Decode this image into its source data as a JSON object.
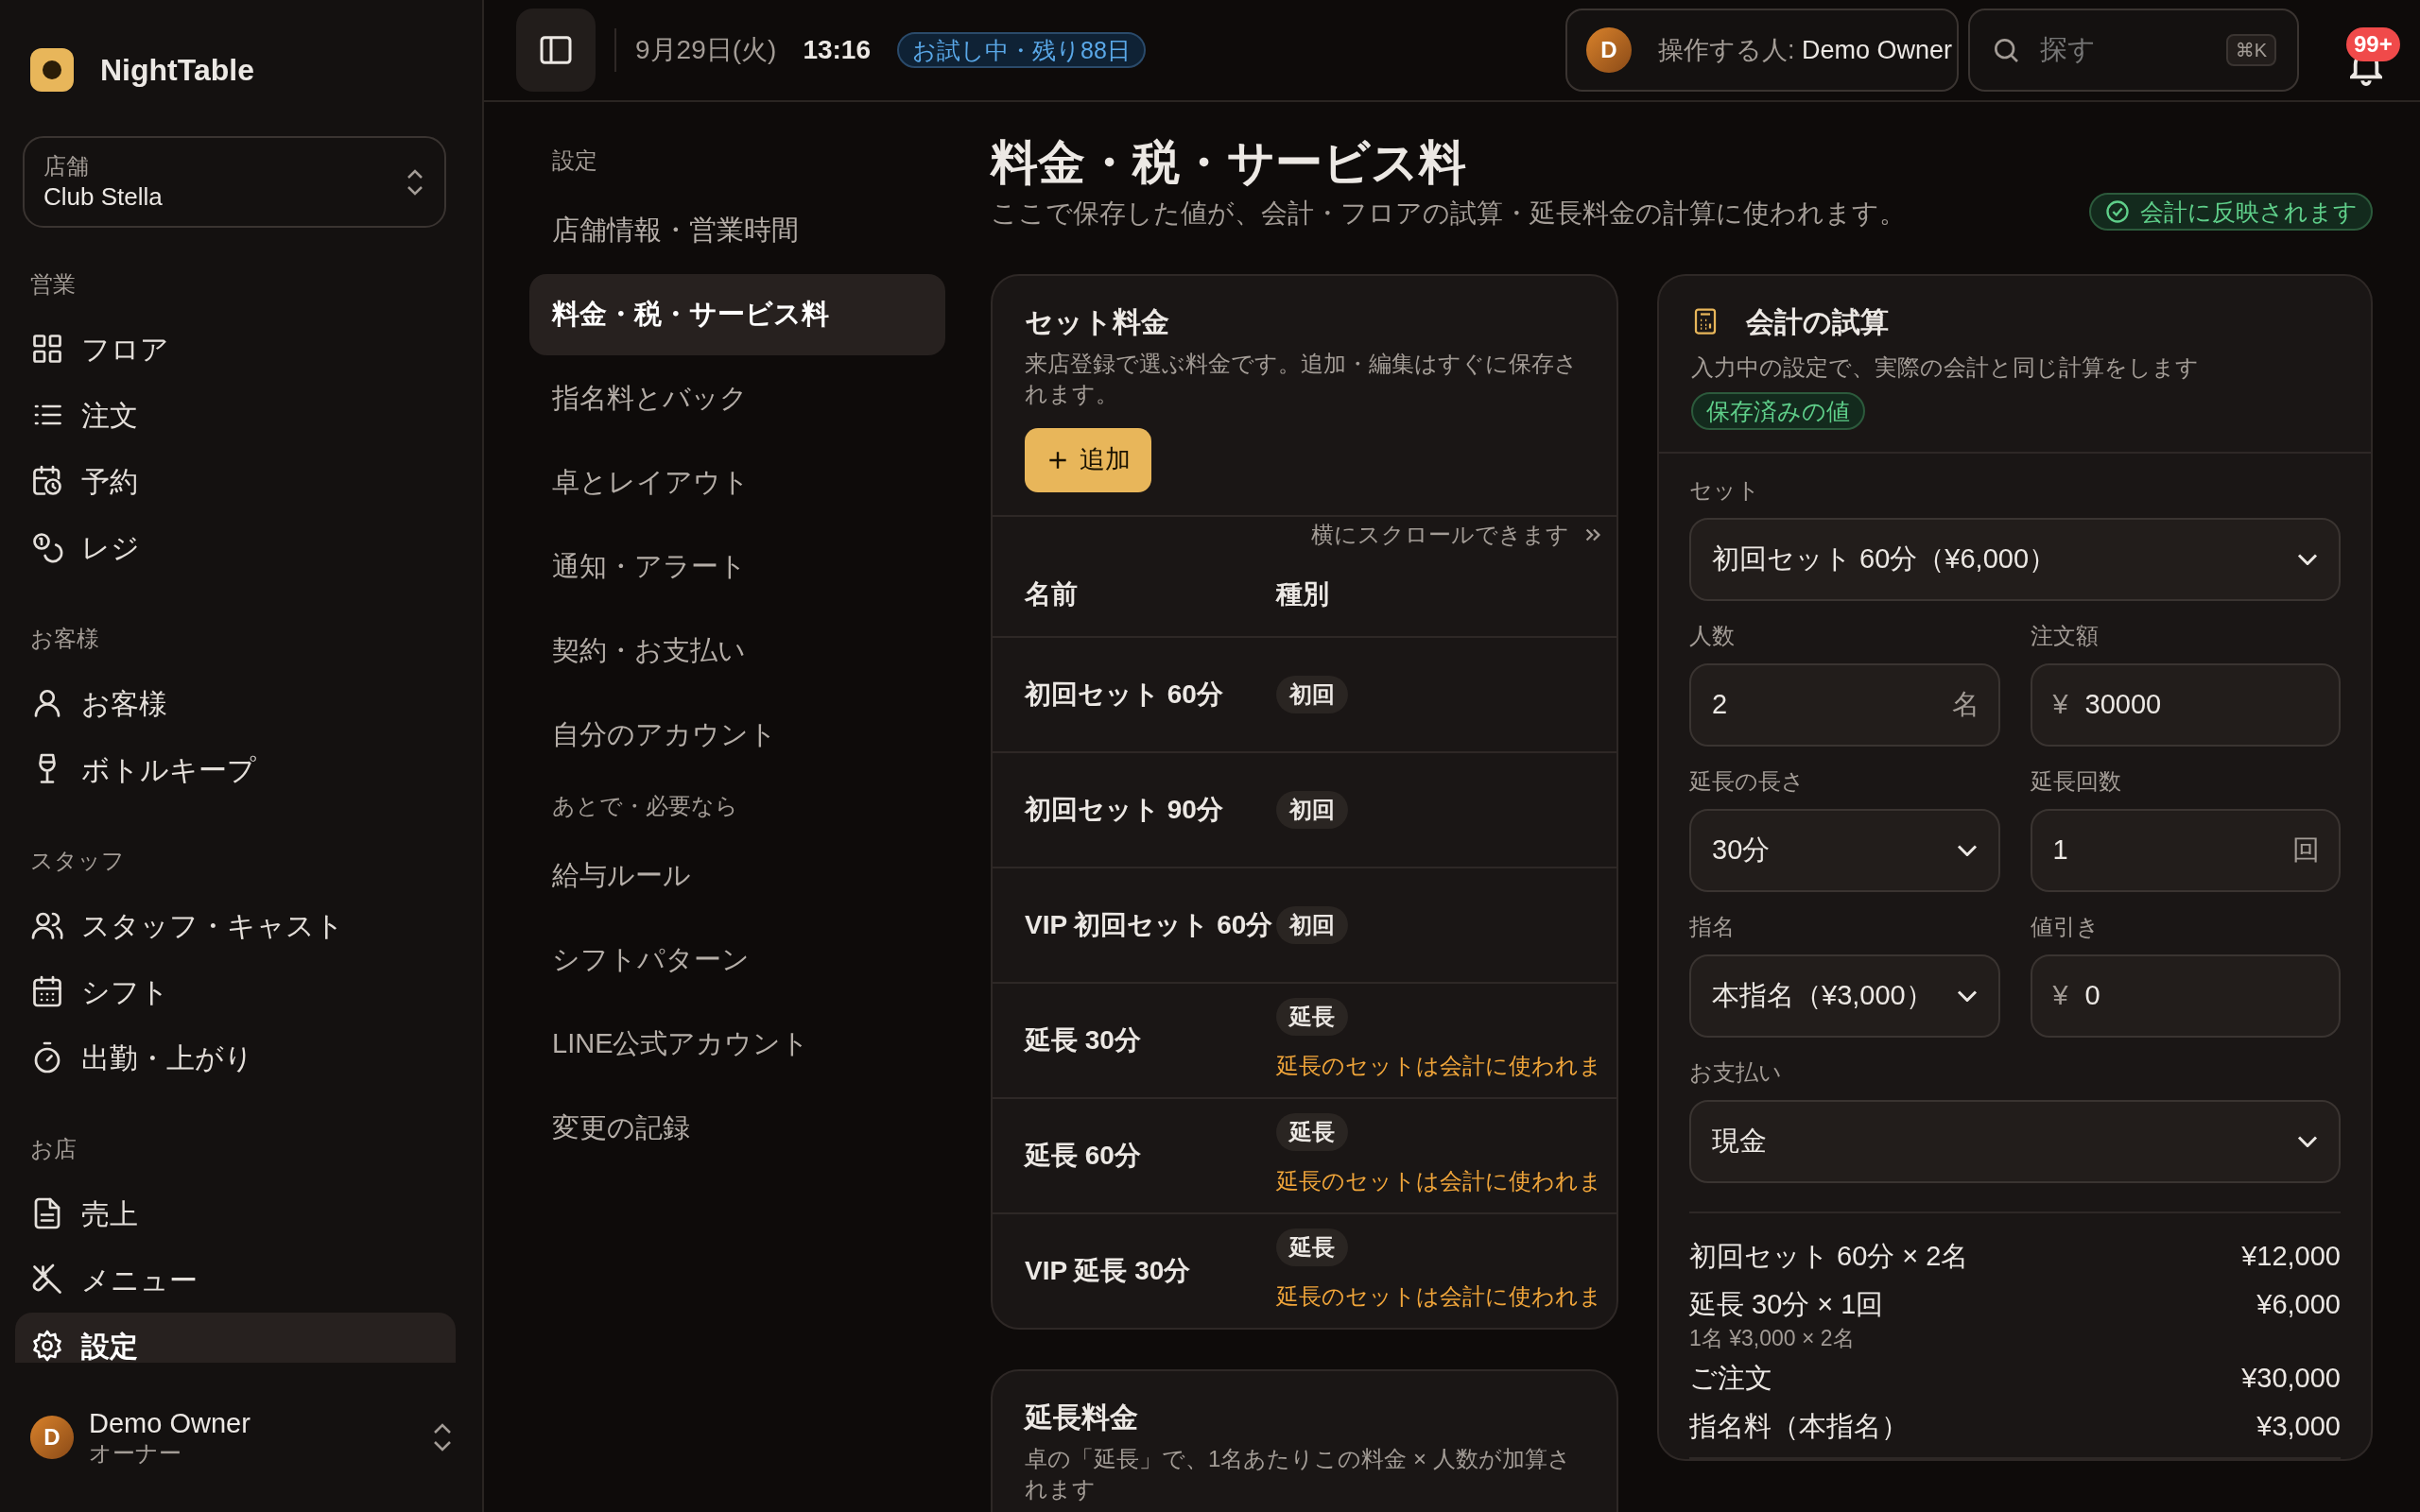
{
  "sidebar": {
    "logo": "NightTable",
    "store": {
      "label": "店舗",
      "name": "Club Stella"
    },
    "sections": [
      {
        "title": "営業",
        "items": [
          {
            "label": "フロア",
            "selected": false
          },
          {
            "label": "注文",
            "selected": false
          },
          {
            "label": "予約",
            "selected": false
          },
          {
            "label": "レジ",
            "selected": false
          }
        ]
      },
      {
        "title": "お客様",
        "items": [
          {
            "label": "お客様",
            "selected": false
          },
          {
            "label": "ボトルキープ",
            "selected": false
          }
        ]
      },
      {
        "title": "スタッフ",
        "items": [
          {
            "label": "スタッフ・キャスト",
            "selected": false
          },
          {
            "label": "シフト",
            "selected": false
          },
          {
            "label": "出勤・上がり",
            "selected": false
          }
        ]
      },
      {
        "title": "お店",
        "items": [
          {
            "label": "売上",
            "selected": false
          },
          {
            "label": "メニュー",
            "selected": false
          },
          {
            "label": "設定",
            "selected": true
          }
        ]
      }
    ],
    "user": {
      "initial": "D",
      "name": "Demo Owner",
      "role": "オーナー"
    }
  },
  "header": {
    "date": "9月29日(火)",
    "time": "13:16",
    "trial_badge": "お試し中・残り88日",
    "operator": {
      "initial": "D",
      "label": "操作する人:",
      "name": "Demo Owner"
    },
    "search": {
      "placeholder": "探す",
      "shortcut": "⌘K"
    },
    "notifications": {
      "count": "99+"
    }
  },
  "settings_nav": [
    {
      "kind": "heading",
      "label": "設定"
    },
    {
      "kind": "link",
      "label": "店舗情報・営業時間",
      "selected": false
    },
    {
      "kind": "link",
      "label": "料金・税・サービス料",
      "selected": true
    },
    {
      "kind": "link",
      "label": "指名料とバック",
      "selected": false
    },
    {
      "kind": "link",
      "label": "卓とレイアウト",
      "selected": false
    },
    {
      "kind": "link",
      "label": "通知・アラート",
      "selected": false
    },
    {
      "kind": "link",
      "label": "契約・お支払い",
      "selected": false
    },
    {
      "kind": "link",
      "label": "自分のアカウント",
      "selected": false
    },
    {
      "kind": "heading",
      "label": "あとで・必要なら"
    },
    {
      "kind": "link",
      "label": "給与ルール",
      "selected": false
    },
    {
      "kind": "link",
      "label": "シフトパターン",
      "selected": false
    },
    {
      "kind": "link",
      "label": "LINE公式アカウント",
      "selected": false
    },
    {
      "kind": "link",
      "label": "変更の記録",
      "selected": false
    }
  ],
  "page": {
    "title": "料金・税・サービス料",
    "subtitle": "ここで保存した値が、会計・フロアの試算・延長料金の計算に使われます。",
    "status_badge": "会計に反映されます"
  },
  "set_fees": {
    "title": "セット料金",
    "description": "来店登録で選ぶ料金です。追加・編集はすぐに保存されます。",
    "add_button": "追加",
    "scroll_hint": "横にスクロールできます",
    "columns": [
      "名前",
      "種別"
    ],
    "rows": [
      {
        "name": "初回セット 60分",
        "type": "初回"
      },
      {
        "name": "初回セット 90分",
        "type": "初回"
      },
      {
        "name": "VIP 初回セット 60分",
        "type": "初回"
      },
      {
        "name": "延長 30分",
        "type": "延長",
        "warning": "延長のセットは会計に使われま"
      },
      {
        "name": "延長 60分",
        "type": "延長",
        "warning": "延長のセットは会計に使われま"
      },
      {
        "name": "VIP 延長 30分",
        "type": "延長",
        "warning": "延長のセットは会計に使われま"
      }
    ]
  },
  "extension_fees": {
    "title": "延長料金",
    "description": "卓の「延長」で、1名あたりこの料金 × 人数が加算されます"
  },
  "calculator": {
    "title": "会計の試算",
    "description": "入力中の設定で、実際の会計と同じ計算をします",
    "saved_badge": "保存済みの値",
    "fields": [
      {
        "label": "セット",
        "kind": "select",
        "value": "初回セット 60分（¥6,000）",
        "wide": true
      },
      {
        "label": "人数",
        "kind": "input",
        "value": "2",
        "suffix": "名",
        "wide": false
      },
      {
        "label": "注文額",
        "kind": "input",
        "value": "30000",
        "prefix": "¥",
        "wide": false
      },
      {
        "label": "延長の長さ",
        "kind": "select",
        "value": "30分",
        "wide": false
      },
      {
        "label": "延長回数",
        "kind": "input",
        "value": "1",
        "suffix": "回",
        "wide": false
      },
      {
        "label": "指名",
        "kind": "select",
        "value": "本指名（¥3,000）",
        "wide": false
      },
      {
        "label": "値引き",
        "kind": "input",
        "value": "0",
        "prefix": "¥",
        "wide": false
      },
      {
        "label": "お支払い",
        "kind": "select",
        "value": "現金",
        "wide": true
      }
    ],
    "lines": [
      {
        "label": "初回セット 60分 × 2名",
        "amount": "¥12,000"
      },
      {
        "label": "延長 30分 × 1回",
        "amount": "¥6,000",
        "note": "1名 ¥3,000 × 2名"
      },
      {
        "label": "ご注文",
        "amount": "¥30,000"
      },
      {
        "label": "指名料（本指名）",
        "amount": "¥3,000"
      }
    ]
  }
}
